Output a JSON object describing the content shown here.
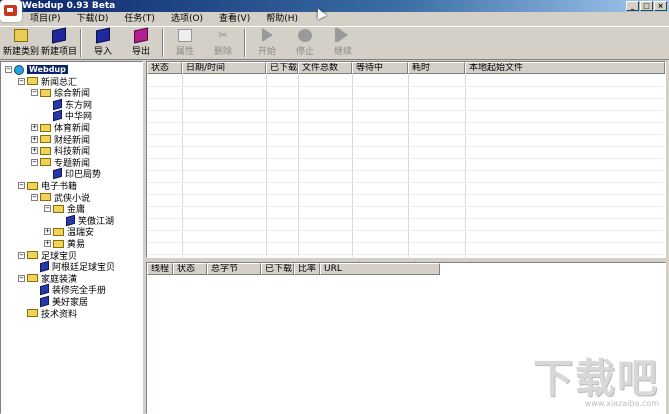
{
  "window": {
    "title": "Webdup 0.93 Beta",
    "min": "_",
    "max": "□",
    "close": "×"
  },
  "menu": [
    {
      "label": "项目(P)"
    },
    {
      "label": "下载(D)"
    },
    {
      "label": "任务(T)"
    },
    {
      "label": "选项(O)"
    },
    {
      "label": "查看(V)"
    },
    {
      "label": "帮助(H)"
    }
  ],
  "toolbar": [
    {
      "label": "新建类别",
      "icon": "folder-icon"
    },
    {
      "label": "新建项目",
      "icon": "book-icon"
    },
    {
      "label": "导入",
      "icon": "import-icon"
    },
    {
      "label": "导出",
      "icon": "export-icon"
    },
    {
      "label": "属性",
      "icon": "properties-icon"
    },
    {
      "label": "删除",
      "icon": "delete-icon"
    },
    {
      "label": "开始",
      "icon": "start-icon"
    },
    {
      "label": "停止",
      "icon": "stop-icon"
    },
    {
      "label": "继续",
      "icon": "resume-icon"
    }
  ],
  "tree": [
    {
      "label": "Webdup",
      "level": 0,
      "type": "root",
      "exp": "-"
    },
    {
      "label": "新闻总汇",
      "level": 1,
      "type": "folder",
      "exp": "-"
    },
    {
      "label": "综合新闻",
      "level": 2,
      "type": "folder",
      "exp": "-"
    },
    {
      "label": "东方网",
      "level": 3,
      "type": "book",
      "exp": ""
    },
    {
      "label": "中华网",
      "level": 3,
      "type": "book",
      "exp": ""
    },
    {
      "label": "体育新闻",
      "level": 2,
      "type": "folder",
      "exp": "+"
    },
    {
      "label": "财经新闻",
      "level": 2,
      "type": "folder",
      "exp": "+"
    },
    {
      "label": "科技新闻",
      "level": 2,
      "type": "folder",
      "exp": "+"
    },
    {
      "label": "专题新闻",
      "level": 2,
      "type": "folder",
      "exp": "-"
    },
    {
      "label": "印巴局势",
      "level": 3,
      "type": "book",
      "exp": ""
    },
    {
      "label": "电子书籍",
      "level": 1,
      "type": "folder",
      "exp": "-"
    },
    {
      "label": "武侠小说",
      "level": 2,
      "type": "folder",
      "exp": "-"
    },
    {
      "label": "金庸",
      "level": 3,
      "type": "folder",
      "exp": "-"
    },
    {
      "label": "笑傲江湖",
      "level": 4,
      "type": "book",
      "exp": ""
    },
    {
      "label": "温瑞安",
      "level": 3,
      "type": "folder",
      "exp": "+"
    },
    {
      "label": "黄易",
      "level": 3,
      "type": "folder",
      "exp": "+"
    },
    {
      "label": "足球宝贝",
      "level": 1,
      "type": "folder",
      "exp": "-"
    },
    {
      "label": "阿根廷足球宝贝",
      "level": 2,
      "type": "book",
      "exp": ""
    },
    {
      "label": "家庭装潢",
      "level": 1,
      "type": "folder",
      "exp": "-"
    },
    {
      "label": "装修完全手册",
      "level": 2,
      "type": "book",
      "exp": ""
    },
    {
      "label": "美好家居",
      "level": 2,
      "type": "book",
      "exp": ""
    },
    {
      "label": "技术资料",
      "level": 1,
      "type": "folder",
      "exp": ""
    }
  ],
  "task_columns": [
    {
      "label": "状态"
    },
    {
      "label": "日期/时间"
    },
    {
      "label": "已下载"
    },
    {
      "label": "文件总数"
    },
    {
      "label": "等待中"
    },
    {
      "label": "耗时"
    },
    {
      "label": "本地起始文件"
    }
  ],
  "thread_columns": [
    {
      "label": "线程"
    },
    {
      "label": "状态"
    },
    {
      "label": "总字节"
    },
    {
      "label": "已下载"
    },
    {
      "label": "比率"
    },
    {
      "label": "URL"
    }
  ],
  "watermark": {
    "logo": "下载吧",
    "url": "www.xiazaiba.com"
  },
  "colors": {
    "titlebar": "#0a246a",
    "face": "#d4d0c8",
    "selection": "#0a246a"
  }
}
